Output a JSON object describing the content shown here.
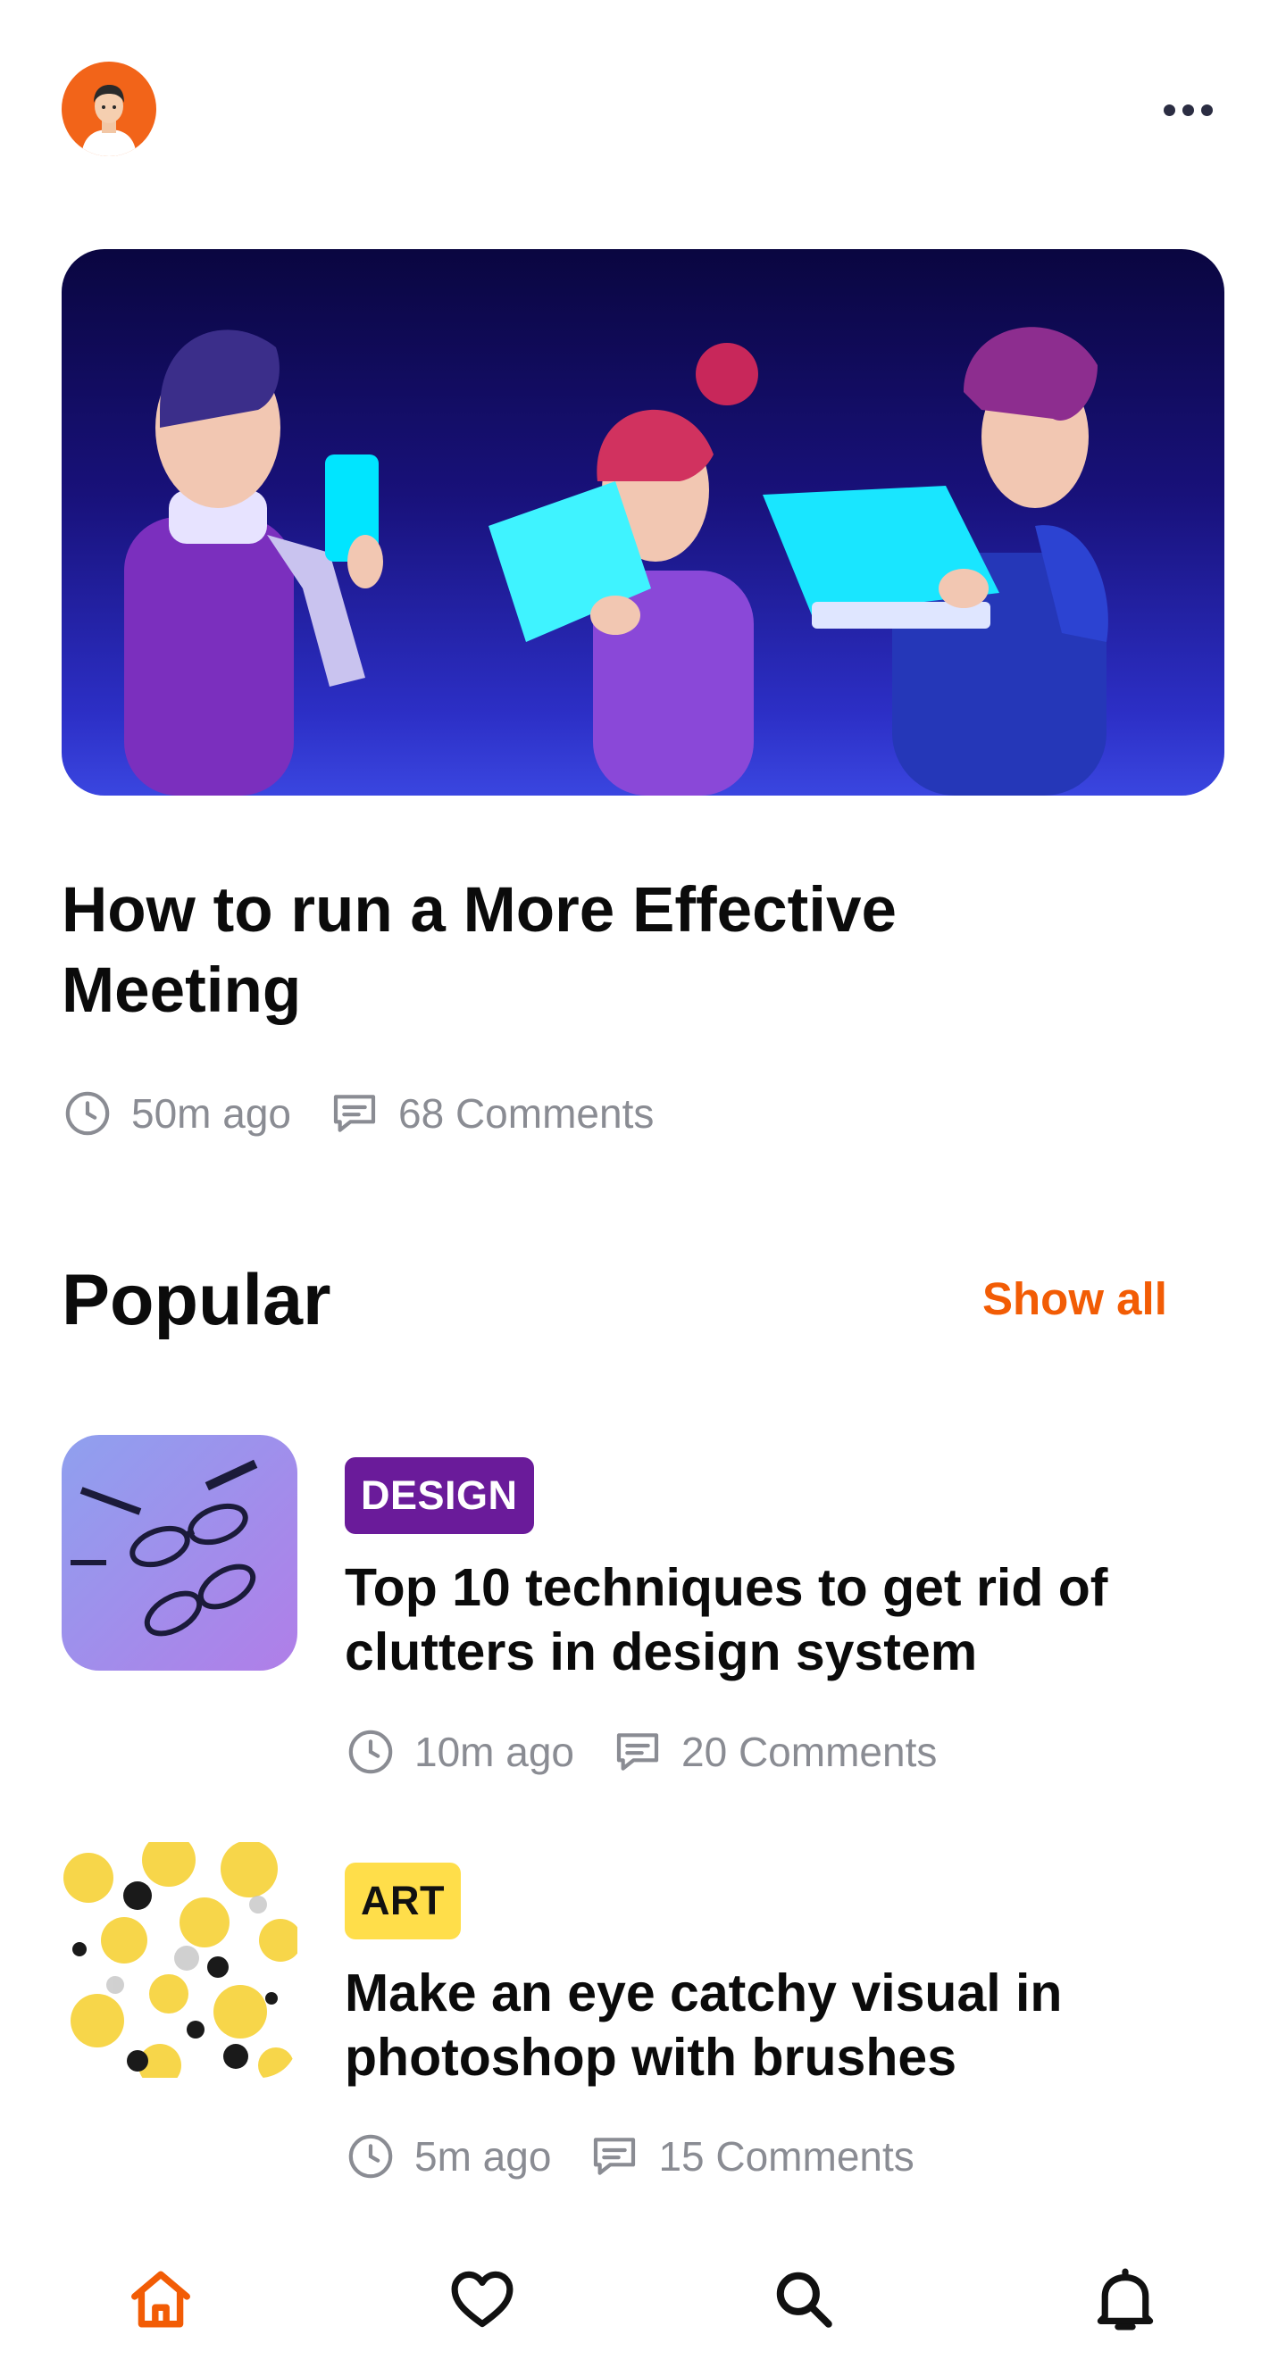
{
  "header": {
    "avatar_icon": "user-avatar",
    "more_icon": "more-horizontal-icon"
  },
  "hero": {
    "title": "How to run a More Effective Meeting",
    "time": "50m ago",
    "comments": "68 Comments"
  },
  "popular": {
    "title": "Popular",
    "show_all": "Show all",
    "items": [
      {
        "tag": "DESIGN",
        "tag_color": "#6a1b9a",
        "title": "Top 10 techniques to get rid of clutters in design system",
        "time": "10m ago",
        "comments": "20 Comments"
      },
      {
        "tag": "ART",
        "tag_color": "#ffde4a",
        "title": "Make an eye catchy visual in photoshop with brushes",
        "time": "5m ago",
        "comments": "15 Comments"
      }
    ]
  },
  "nav": {
    "items": [
      {
        "icon": "home-icon",
        "active": true
      },
      {
        "icon": "heart-icon",
        "active": false
      },
      {
        "icon": "search-icon",
        "active": false
      },
      {
        "icon": "bell-icon",
        "active": false
      }
    ],
    "accent": "#f25c05"
  }
}
